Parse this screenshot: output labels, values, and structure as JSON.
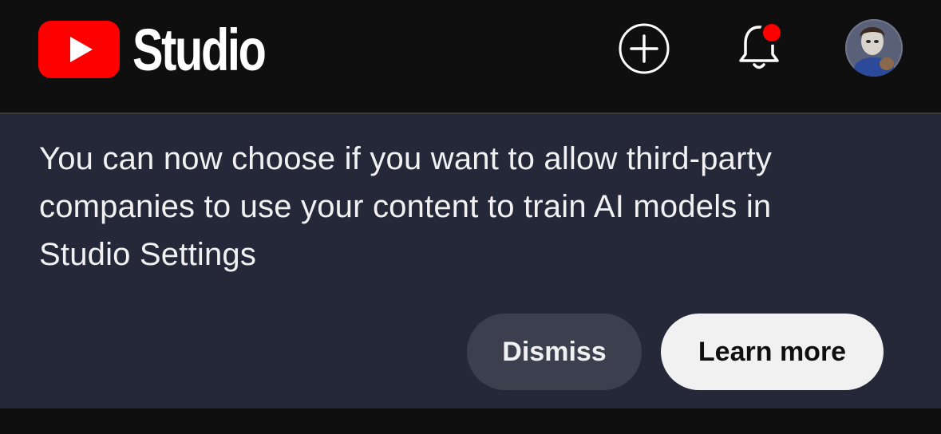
{
  "header": {
    "app_name": "Studio",
    "logo_icon": "youtube-play-icon",
    "create_icon": "plus-circle-icon",
    "notifications_icon": "bell-icon",
    "notification_indicator_color": "#ff0000",
    "brand_color": "#ff0000",
    "avatar_icon": "user-avatar"
  },
  "banner": {
    "message": "You can now choose if you want to allow third-party companies to use your content to train AI models in Studio Settings",
    "dismiss_label": "Dismiss",
    "learn_more_label": "Learn more",
    "background_color": "#252839"
  }
}
